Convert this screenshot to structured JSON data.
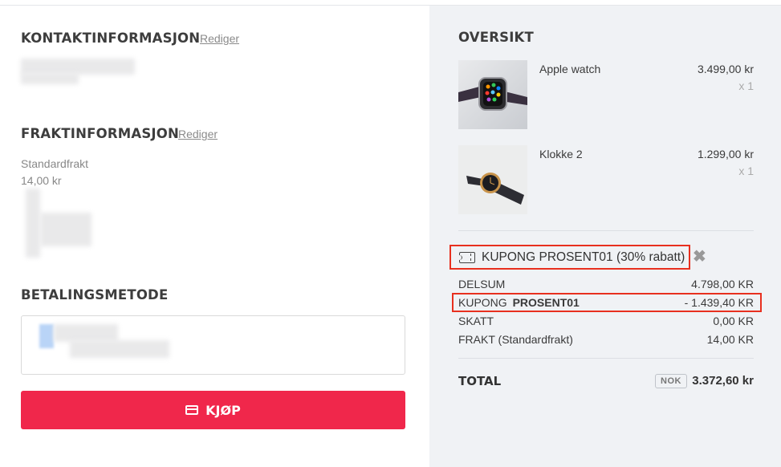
{
  "contact": {
    "title": "KONTAKTINFORMASJON",
    "edit": "Rediger"
  },
  "shipping": {
    "title": "FRAKTINFORMASJON",
    "edit": "Rediger",
    "method": "Standardfrakt",
    "price": "14,00 kr"
  },
  "payment": {
    "title": "BETALINGSMETODE"
  },
  "buy_button": {
    "label": "KJØP",
    "color": "#f0274b"
  },
  "overview": {
    "title": "OVERSIKT",
    "items": [
      {
        "name": "Apple watch",
        "price": "3.499,00 kr",
        "qty": "x 1"
      },
      {
        "name": "Klokke 2",
        "price": "1.299,00 kr",
        "qty": "x 1"
      }
    ],
    "coupon_tag": "KUPONG PROSENT01 (30% rabatt)",
    "remove": "✖",
    "subtotal": {
      "label": "DELSUM",
      "value": "4.798,00 KR"
    },
    "coupon": {
      "label": "KUPONG",
      "code": "PROSENT01",
      "value": "- 1.439,40 KR"
    },
    "tax": {
      "label": "SKATT",
      "value": "0,00 KR"
    },
    "freight": {
      "label": "FRAKT (Standardfrakt)",
      "value": "14,00 KR"
    },
    "total": {
      "label": "TOTAL",
      "currency": "NOK",
      "value": "3.372,60 kr"
    }
  },
  "colors": {
    "highlight": "#e8301f",
    "sidebar_bg": "#f0f2f5"
  }
}
